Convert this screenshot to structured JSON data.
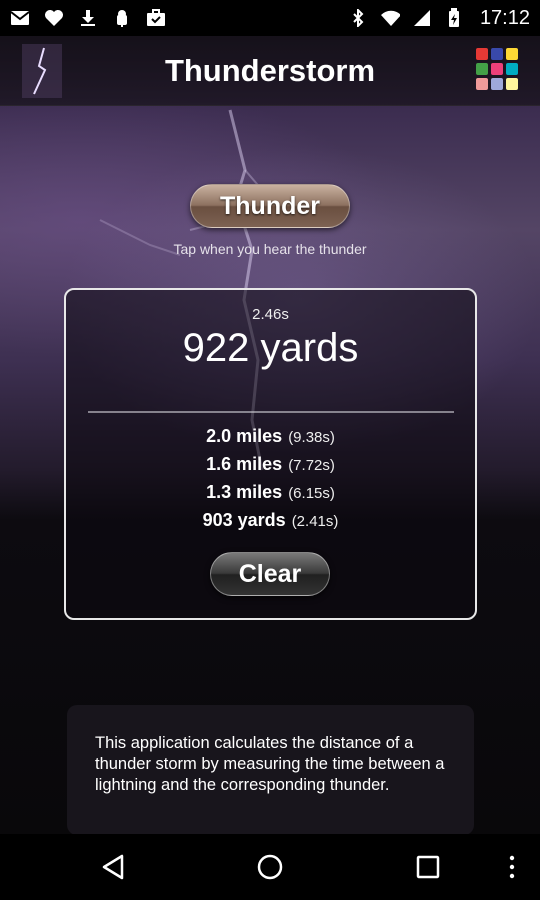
{
  "status_bar": {
    "time": "17:12",
    "icons_left": [
      "gmail-icon",
      "heart-icon",
      "download-icon",
      "android-debug-icon",
      "briefcase-check-icon"
    ],
    "icons_right": [
      "bluetooth-icon",
      "wifi-icon",
      "cell-signal-icon",
      "battery-icon"
    ]
  },
  "app_bar": {
    "title": "Thunderstorm",
    "logo_icon": "lightning-icon",
    "menu_icon": "color-grid-icon",
    "grid_colors": [
      "#e53935",
      "#3949ab",
      "#fdd835",
      "#43a047",
      "#ec407a",
      "#00acc1",
      "#ef9a9a",
      "#9fa8da",
      "#fff59d"
    ]
  },
  "main": {
    "thunder_button_label": "Thunder",
    "hint": "Tap when you hear the thunder",
    "current": {
      "time": "2.46s",
      "distance": "922 yards"
    },
    "history": [
      {
        "distance": "2.0 miles",
        "time": "(9.38s)"
      },
      {
        "distance": "1.6 miles",
        "time": "(7.72s)"
      },
      {
        "distance": "1.3 miles",
        "time": "(6.15s)"
      },
      {
        "distance": "903 yards",
        "time": "(2.41s)"
      }
    ],
    "clear_button_label": "Clear"
  },
  "info": {
    "text": "This application calculates the distance of a thunder storm by measuring the time between a lightning and the corresponding thunder."
  },
  "nav_bar": {
    "buttons": [
      "back-icon",
      "home-icon",
      "recents-icon",
      "overflow-menu-icon"
    ]
  },
  "colors": {
    "thunder_button": "#8d7160",
    "clear_button": "#3a3a3a",
    "sky": "#544565"
  }
}
